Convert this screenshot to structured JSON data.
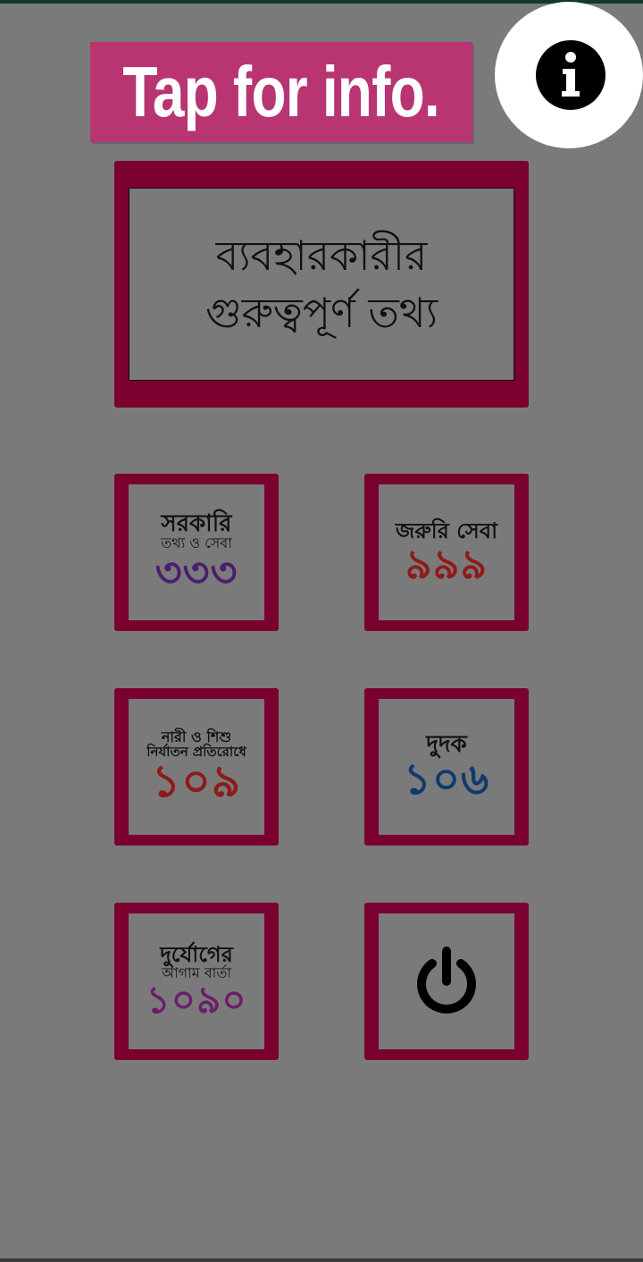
{
  "banner": {
    "label": "Tap for info."
  },
  "main_tile": {
    "line1": "ব্যবহারকারীর",
    "line2": "গুরুত্বপূর্ণ তথ্য"
  },
  "tiles": [
    {
      "head": "সরকারি",
      "sub": "তথ্য ও সেবা",
      "number": "৩৩৩",
      "number_color": "#4a1e6e"
    },
    {
      "head": "জরুরি সেবা",
      "sub": "",
      "number": "৯৯৯",
      "number_color": "#8f1a1a"
    },
    {
      "head": "নারী ও শিশু",
      "sub": "নির্যাতন প্রতিরোধে",
      "number": "১০৯",
      "number_color": "#8f1a1a"
    },
    {
      "head": "দুদক",
      "sub": "",
      "number": "১০৬",
      "number_color": "#0f3a6e"
    },
    {
      "head": "দুর্যোগের",
      "sub": "আগাম বার্তা",
      "number": "১০৯০",
      "number_color": "#6a1e6a"
    }
  ],
  "icons": {
    "info": "info-icon",
    "power": "power-icon"
  },
  "colors": {
    "background": "#7a7a7a",
    "tile_frame": "#7a0030",
    "banner": "#b83572",
    "status_bar": "#0e3a32"
  }
}
